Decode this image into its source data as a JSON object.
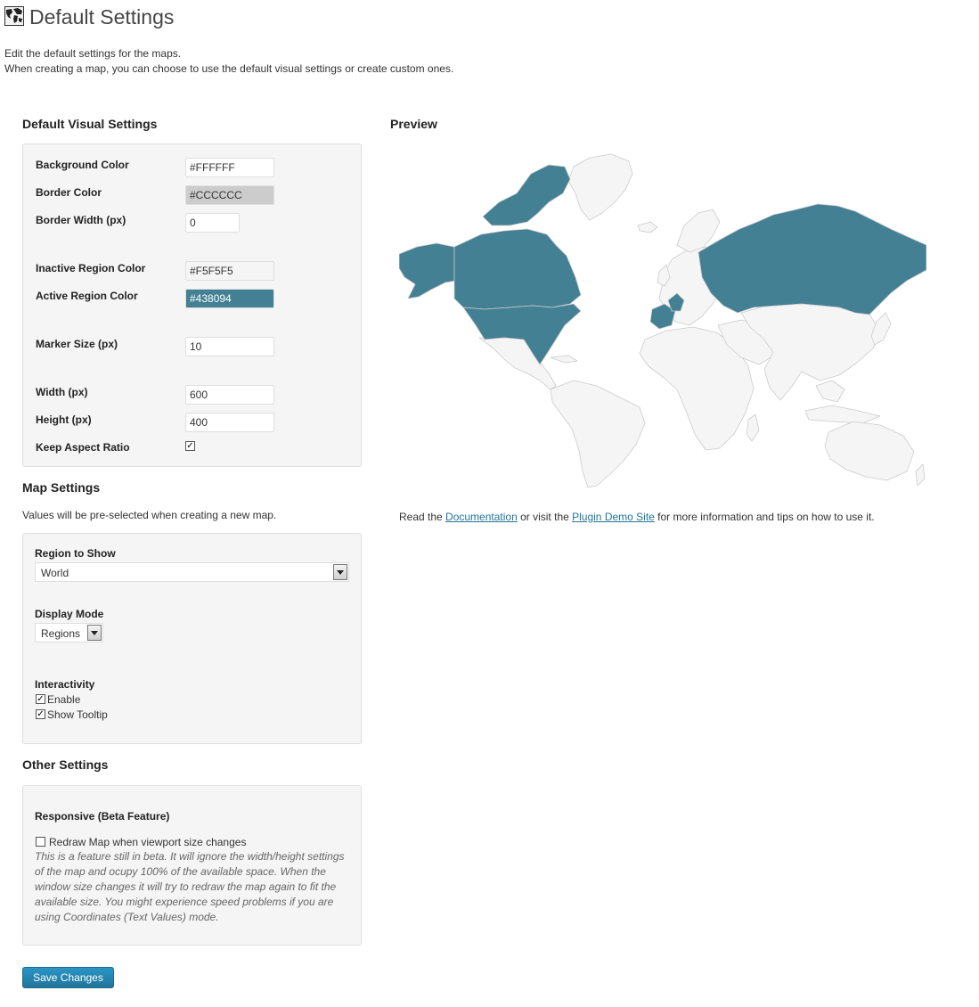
{
  "page": {
    "title": "Default Settings",
    "intro_line1": "Edit the default settings for the maps.",
    "intro_line2": "When creating a map, you can choose to use the default visual settings or create custom ones."
  },
  "visual": {
    "heading": "Default Visual Settings",
    "background_color": {
      "label": "Background Color",
      "value": "#FFFFFF"
    },
    "border_color": {
      "label": "Border Color",
      "value": "#CCCCCC"
    },
    "border_width": {
      "label": "Border Width (px)",
      "value": "0"
    },
    "inactive_color": {
      "label": "Inactive Region Color",
      "value": "#F5F5F5"
    },
    "active_color": {
      "label": "Active Region Color",
      "value": "#438094"
    },
    "marker_size": {
      "label": "Marker Size (px)",
      "value": "10"
    },
    "width": {
      "label": "Width (px)",
      "value": "600"
    },
    "height": {
      "label": "Height (px)",
      "value": "400"
    },
    "keep_aspect": {
      "label": "Keep Aspect Ratio",
      "checked": true
    }
  },
  "map_settings": {
    "heading": "Map Settings",
    "description": "Values will be pre-selected when creating a new map.",
    "region_label": "Region to Show",
    "region_value": "World",
    "display_label": "Display Mode",
    "display_value": "Regions",
    "interactivity_label": "Interactivity",
    "enable_label": "Enable",
    "enable_checked": true,
    "tooltip_label": "Show Tooltip",
    "tooltip_checked": true
  },
  "other_settings": {
    "heading": "Other Settings",
    "responsive_label": "Responsive (Beta Feature)",
    "redraw_label": "Redraw Map when viewport size changes",
    "redraw_checked": false,
    "beta_note": "This is a feature still in beta. It will ignore the width/height settings of the map and ocupy 100% of the available space. When the window size changes it will try to redraw the map again to fit the available size. You might experience speed problems if you are using Coordinates (Text Values) mode."
  },
  "preview": {
    "heading": "Preview",
    "info_prefix": "Read the ",
    "doc_link": "Documentation",
    "info_middle": " or visit the ",
    "demo_link": "Plugin Demo Site",
    "info_suffix": " for more information and tips on how to use it."
  },
  "colors": {
    "active_region": "#438094",
    "inactive_region": "#F5F5F5",
    "region_border": "#CCCCCC",
    "accent": "#21759B"
  },
  "icons": {
    "title": "world-map-icon"
  },
  "save_label": "Save Changes"
}
